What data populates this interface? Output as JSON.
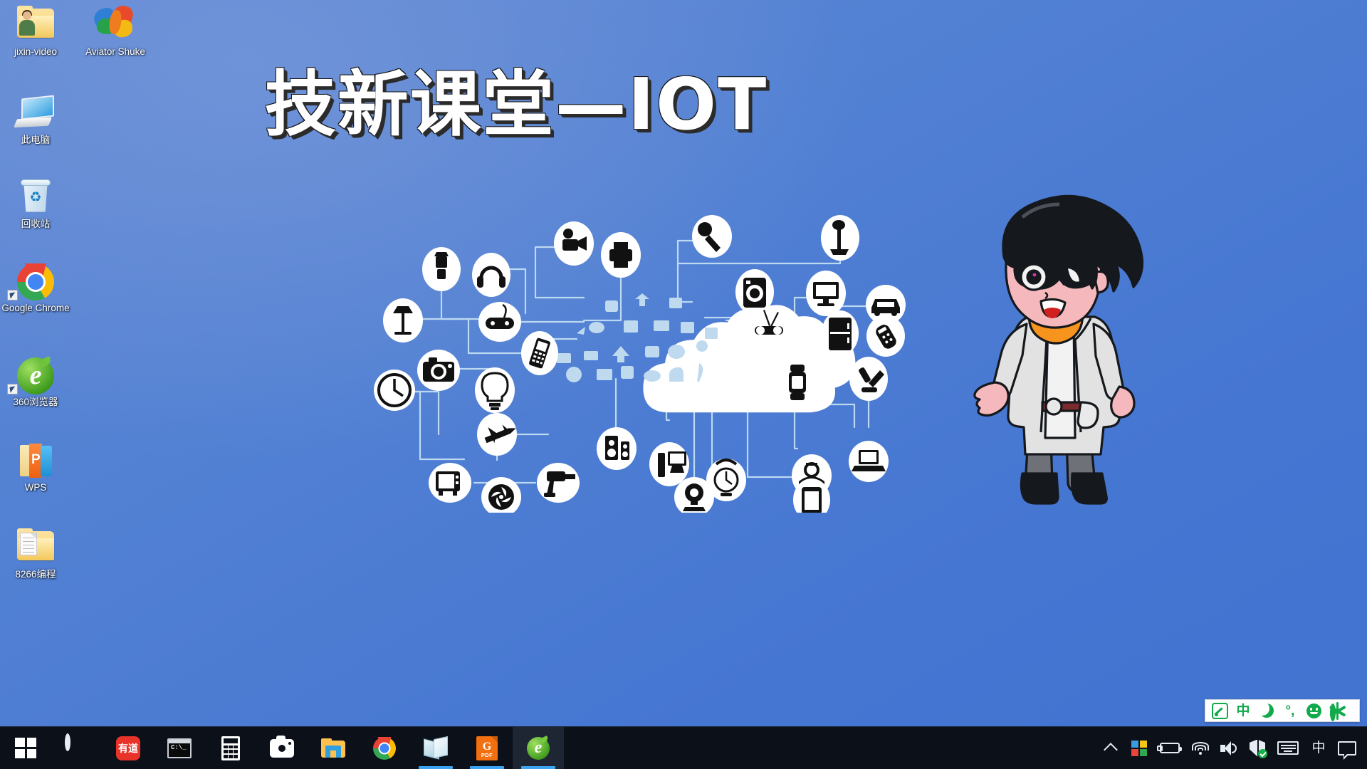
{
  "desktop": {
    "wallpaper": {
      "title": "技新课堂—IOT",
      "gradient_from": "#6189d4",
      "gradient_to": "#4576d2"
    },
    "icons": [
      {
        "label": "jixin-video",
        "icon": "folder-user-icon",
        "shortcut": false
      },
      {
        "label": "Aviator Shuke",
        "icon": "butterfly-icon",
        "shortcut": false
      },
      {
        "label": "此电脑",
        "icon": "this-pc-icon",
        "shortcut": false
      },
      {
        "label": "回收站",
        "icon": "recycle-bin-icon",
        "shortcut": false
      },
      {
        "label": "Google Chrome",
        "icon": "chrome-icon",
        "shortcut": true
      },
      {
        "label": "360浏览器",
        "icon": "360-browser-icon",
        "shortcut": true
      },
      {
        "label": "WPS",
        "icon": "wps-office-icon",
        "shortcut": false
      },
      {
        "label": "8266编程",
        "icon": "folder-document-icon",
        "shortcut": false
      }
    ]
  },
  "iot_diagram": {
    "center_label": "cloud",
    "line_color": "#bcd9f2",
    "node_fill": "#ffffff",
    "glyph_color": "#111111",
    "nodes": [
      "blender-icon",
      "headphones-icon",
      "camcorder-icon",
      "printer-icon",
      "microphone-icon",
      "vacuum-cleaner-icon",
      "floor-lamp-icon",
      "game-controller-icon",
      "washing-machine-icon",
      "desktop-monitor-icon",
      "car-icon",
      "mobile-phone-icon",
      "camera-icon",
      "router-icon",
      "refrigerator-icon",
      "wall-clock-icon",
      "light-bulb-icon",
      "smart-watch-icon",
      "desk-lamp-icon",
      "remote-control-icon",
      "speaker-icon",
      "power-drill-icon",
      "pc-tower-icon",
      "kitchen-scale-icon",
      "telephone-icon",
      "laptop-icon",
      "tv-icon",
      "fan-icon",
      "airplane-icon",
      "webcam-icon",
      "tablet-icon"
    ],
    "cloud_glyphs": [
      "shopping-bag",
      "cloud-upload",
      "calendar",
      "database",
      "presentation",
      "cloud-monitor",
      "document-image",
      "cursor",
      "shopping-cart",
      "location-pin",
      "chat-bubble",
      "search",
      "envelope",
      "home",
      "microchip",
      "photo-frame",
      "clock",
      "coins",
      "ghost",
      "music-note",
      "calendar-74"
    ]
  },
  "mascot": {
    "name": "boy-scientist-mascot",
    "hair_color": "#15181c",
    "skin_color": "#f4b8bd",
    "coat_color": "#dcdcdc",
    "scarf_color": "#f7941d"
  },
  "ime_bar": {
    "items": [
      {
        "name": "ime-logo-icon",
        "label": ""
      },
      {
        "name": "ime-chinese-mode-icon",
        "label": "中"
      },
      {
        "name": "ime-moon-icon",
        "label": ""
      },
      {
        "name": "ime-punctuation-icon",
        "label": "°,"
      },
      {
        "name": "ime-emoji-icon",
        "label": ""
      },
      {
        "name": "ime-settings-icon",
        "label": ""
      }
    ],
    "accent_color": "#12a94b",
    "background": "#ffffff"
  },
  "taskbar": {
    "background": "#0b1019",
    "accent_color": "#3ba3f0",
    "buttons": [
      {
        "name": "start-button",
        "icon": "windows-logo-icon",
        "label": "开始",
        "state": "idle"
      },
      {
        "name": "cortana-button",
        "icon": "cortana-icon",
        "label": "Cortana",
        "state": "idle"
      },
      {
        "name": "youdao-button",
        "icon": "youdao-icon",
        "label": "有道",
        "state": "idle"
      },
      {
        "name": "command-prompt-button",
        "icon": "terminal-icon",
        "label": "命令提示符",
        "state": "idle"
      },
      {
        "name": "calculator-button",
        "icon": "calculator-icon",
        "label": "计算器",
        "state": "idle"
      },
      {
        "name": "camera-button",
        "icon": "camera-icon",
        "label": "相机",
        "state": "idle"
      },
      {
        "name": "file-explorer-button",
        "icon": "folder-icon",
        "label": "文件资源管理器",
        "state": "idle"
      },
      {
        "name": "chrome-button",
        "icon": "chrome-icon",
        "label": "Google Chrome",
        "state": "idle"
      },
      {
        "name": "notes-button",
        "icon": "note-pages-icon",
        "label": "便笺",
        "state": "running"
      },
      {
        "name": "pdf-button",
        "icon": "pdf-icon",
        "label": "PDF",
        "state": "running"
      },
      {
        "name": "360-browser-button",
        "icon": "360-browser-icon",
        "label": "360浏览器",
        "state": "active"
      }
    ],
    "tray": [
      {
        "name": "show-hidden-icons-button",
        "icon": "chevron-up-icon",
        "label": ""
      },
      {
        "name": "app-tiles-icon",
        "icon": "four-squares-icon",
        "label": ""
      },
      {
        "name": "battery-icon",
        "icon": "battery-charging-icon",
        "label": ""
      },
      {
        "name": "network-icon",
        "icon": "wifi-icon",
        "label": ""
      },
      {
        "name": "volume-icon",
        "icon": "speaker-icon",
        "label": ""
      },
      {
        "name": "security-icon",
        "icon": "shield-check-icon",
        "label": ""
      },
      {
        "name": "touch-keyboard-icon",
        "icon": "keyboard-icon",
        "label": ""
      },
      {
        "name": "ime-indicator",
        "icon": "ime-chinese-icon",
        "label": "中"
      },
      {
        "name": "action-center-icon",
        "icon": "chat-bubble-icon",
        "label": ""
      }
    ]
  }
}
